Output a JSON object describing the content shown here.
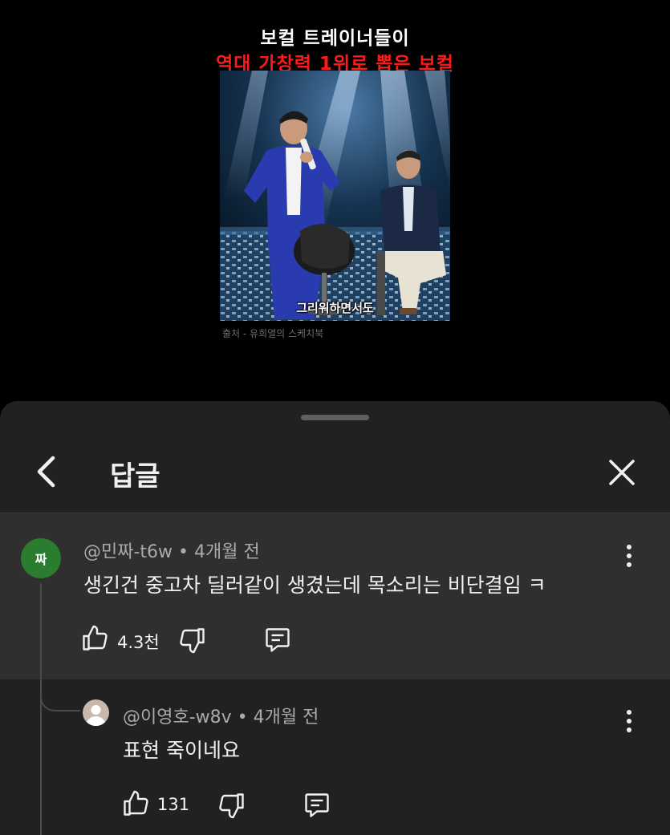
{
  "video": {
    "title_line1": "보컬 트레이너들이",
    "title_line2": "역대 가창력 1위로 뽑은 보컬",
    "subtitle": "그리워하면서도",
    "source": "출처 - 유희열의 스케치북"
  },
  "sheet": {
    "title": "답글"
  },
  "parent_comment": {
    "avatar_letter": "짜",
    "author": "@민짜-t6w",
    "time": "4개월 전",
    "text": "생긴건 중고차 딜러같이 생겼는데 목소리는 비단결임 ㅋ",
    "likes": "4.3천"
  },
  "reply": {
    "author": "@이영호-w8v",
    "time": "4개월 전",
    "text": "표현 죽이네요",
    "likes": "131"
  },
  "colors": {
    "background": "#000000",
    "sheet": "#212121",
    "highlight": "#2f2f2f",
    "title_red": "#ff1a1a",
    "avatar_green": "#2a7d2e"
  }
}
